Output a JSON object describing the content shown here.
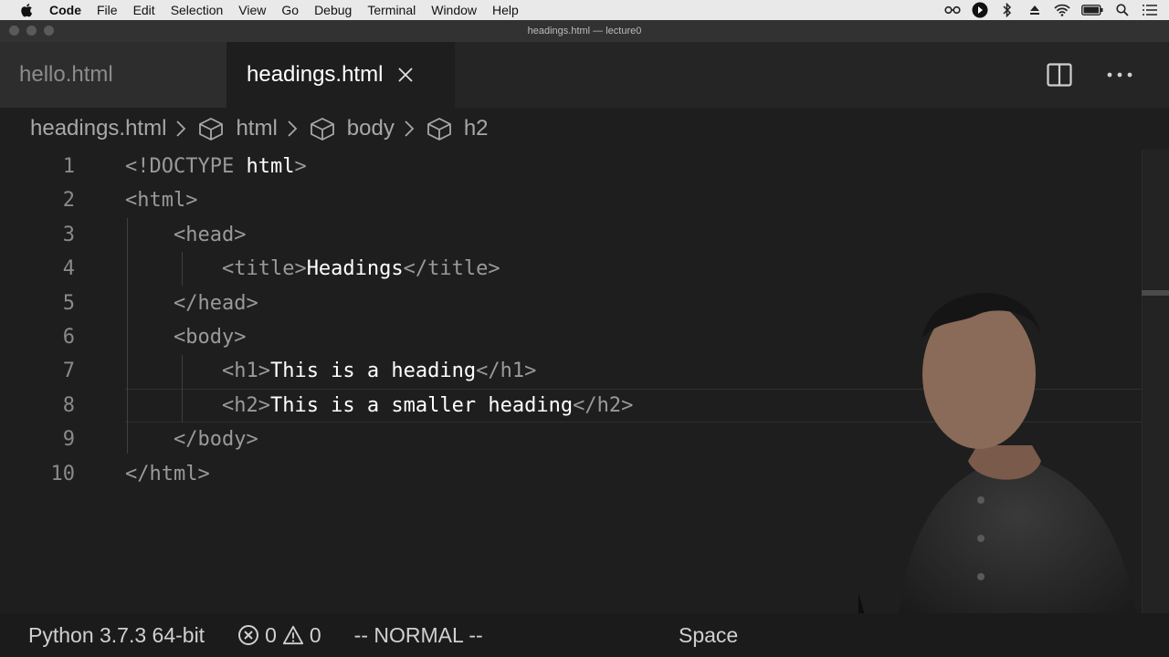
{
  "menubar": {
    "app_name": "Code",
    "items": [
      "File",
      "Edit",
      "Selection",
      "View",
      "Go",
      "Debug",
      "Terminal",
      "Window",
      "Help"
    ]
  },
  "window": {
    "title": "headings.html — lecture0"
  },
  "tabs": [
    {
      "label": "hello.html",
      "active": false
    },
    {
      "label": "headings.html",
      "active": true
    }
  ],
  "breadcrumb": [
    "headings.html",
    "html",
    "body",
    "h2"
  ],
  "editor": {
    "line_numbers": [
      "1",
      "2",
      "3",
      "4",
      "5",
      "6",
      "7",
      "8",
      "9",
      "10"
    ],
    "lines": [
      {
        "indent": "",
        "parts": [
          {
            "t": "tag",
            "v": "<!DOCTYPE "
          },
          {
            "t": "txt",
            "v": "html"
          },
          {
            "t": "tag",
            "v": ">"
          }
        ]
      },
      {
        "indent": "",
        "parts": [
          {
            "t": "tag",
            "v": "<html>"
          }
        ]
      },
      {
        "indent": "    ",
        "parts": [
          {
            "t": "tag",
            "v": "<head>"
          }
        ]
      },
      {
        "indent": "        ",
        "parts": [
          {
            "t": "tag",
            "v": "<title>"
          },
          {
            "t": "txt",
            "v": "Headings"
          },
          {
            "t": "tag",
            "v": "</title>"
          }
        ]
      },
      {
        "indent": "    ",
        "parts": [
          {
            "t": "tag",
            "v": "</head>"
          }
        ]
      },
      {
        "indent": "    ",
        "parts": [
          {
            "t": "tag",
            "v": "<body>"
          }
        ]
      },
      {
        "indent": "        ",
        "parts": [
          {
            "t": "tag",
            "v": "<h1>"
          },
          {
            "t": "txt",
            "v": "This is a heading"
          },
          {
            "t": "tag",
            "v": "</h1>"
          }
        ]
      },
      {
        "indent": "        ",
        "parts": [
          {
            "t": "tag",
            "v": "<h2>"
          },
          {
            "t": "txt",
            "v": "This is a smaller heading"
          },
          {
            "t": "tag",
            "v": "</h2>"
          }
        ]
      },
      {
        "indent": "    ",
        "parts": [
          {
            "t": "tag",
            "v": "</body>"
          }
        ]
      },
      {
        "indent": "",
        "parts": [
          {
            "t": "tag",
            "v": "</html>"
          }
        ]
      }
    ]
  },
  "statusbar": {
    "python": "Python 3.7.3 64-bit",
    "errors": "0",
    "warnings": "0",
    "mode": "-- NORMAL --",
    "indentation": "Space"
  },
  "colors": {
    "editor_bg": "#1e1e1e",
    "tag": "#9a9a9a",
    "text": "#ffffff"
  }
}
